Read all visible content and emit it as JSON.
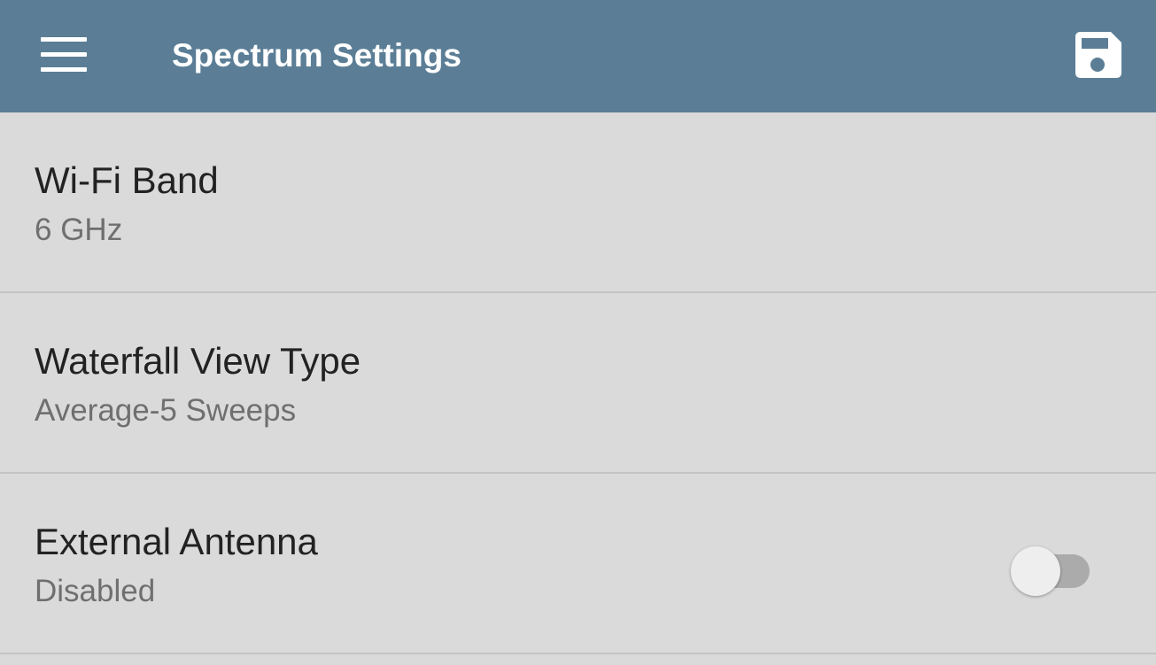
{
  "app_bar": {
    "title": "Spectrum Settings",
    "background_color": "#5b7e96",
    "menu_icon": "hamburger-menu-icon",
    "save_icon": "floppy-disk-save-icon"
  },
  "settings": [
    {
      "label": "Wi-Fi Band",
      "value": "6 GHz"
    },
    {
      "label": "Waterfall View Type",
      "value": "Average-5 Sweeps"
    },
    {
      "label": "External Antenna",
      "value": "Disabled",
      "toggle_on": false
    }
  ]
}
